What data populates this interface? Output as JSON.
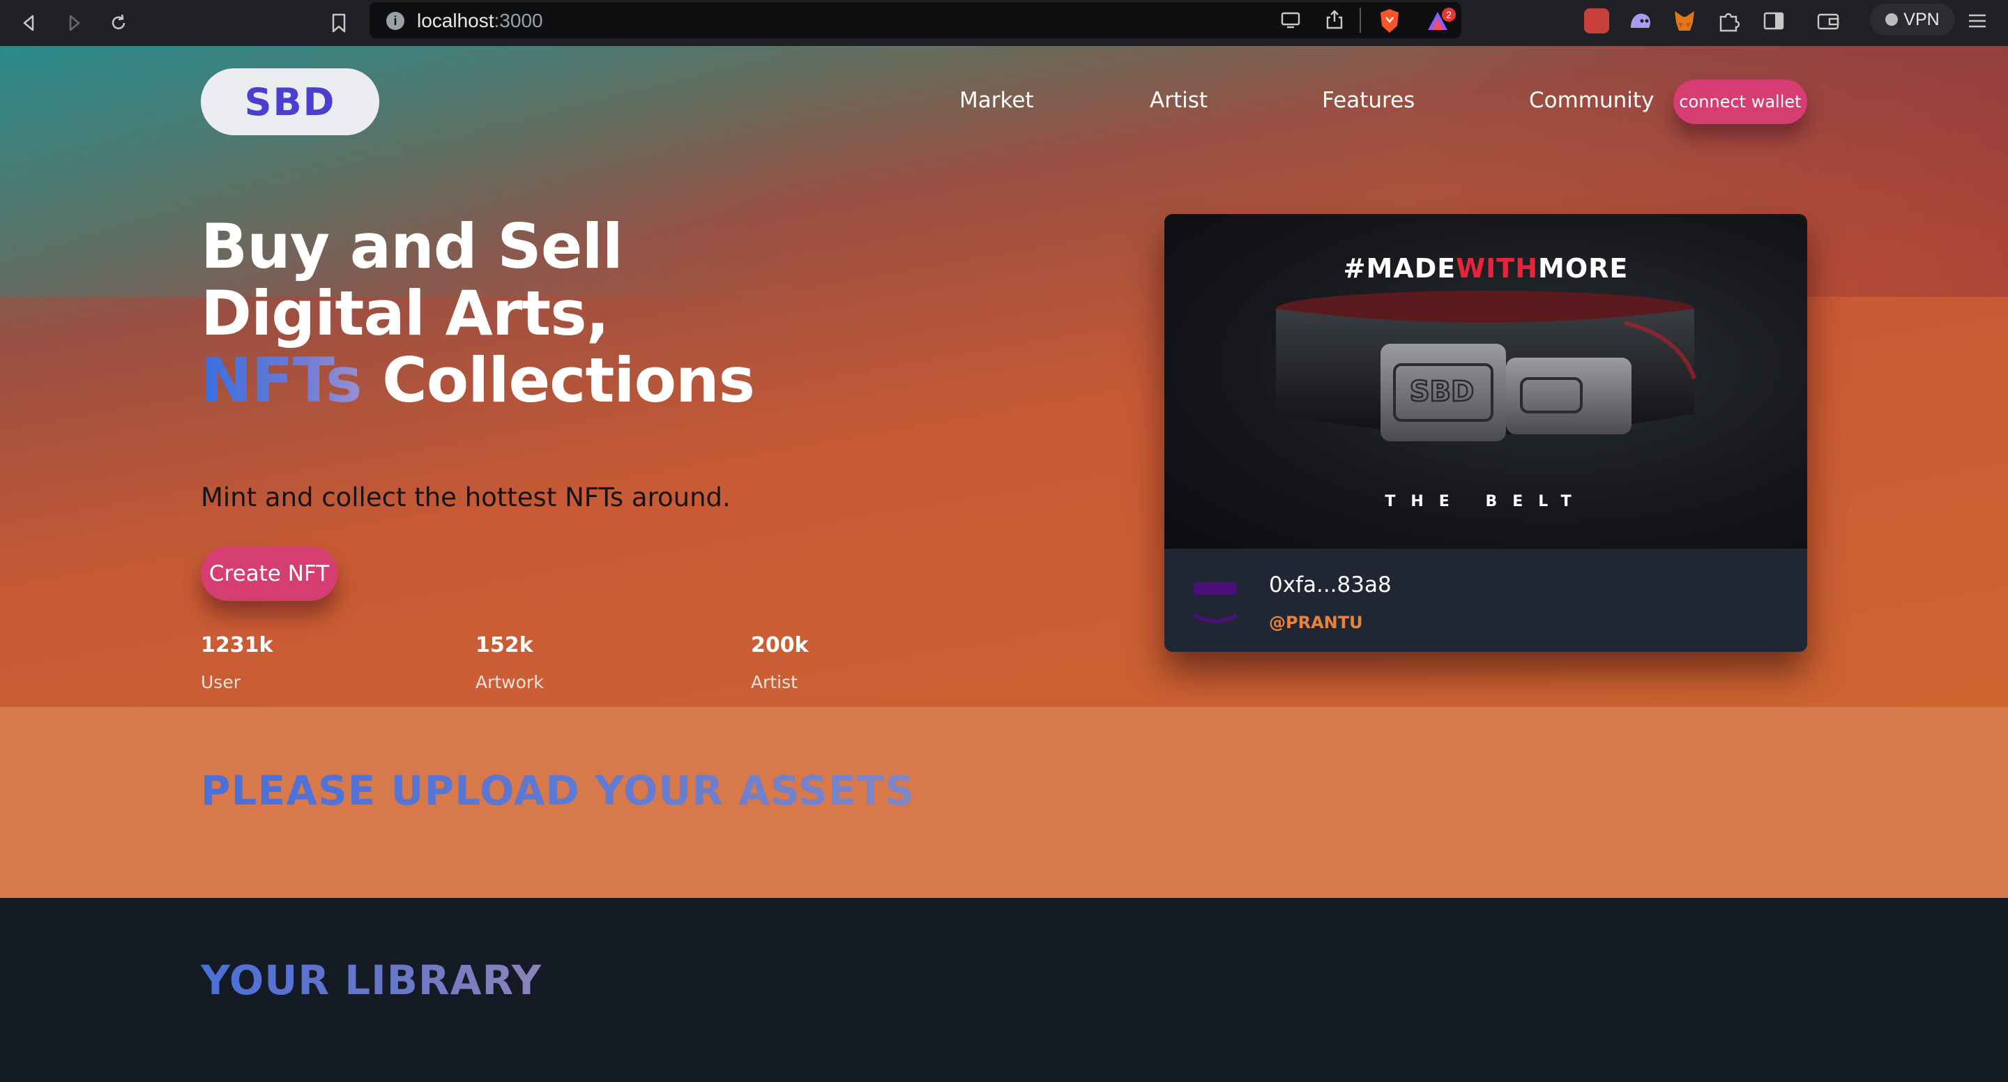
{
  "browser": {
    "url_host": "localhost",
    "url_port": ":3000",
    "vpn_label": "VPN",
    "notification_count": "2"
  },
  "nav": {
    "logo": "SBD",
    "links": [
      "Market",
      "Artist",
      "Features",
      "Community"
    ],
    "connect_label": "connect wallet"
  },
  "hero": {
    "line1": "Buy and Sell",
    "line2": "Digital Arts,",
    "line3_highlight": "NFTs",
    "line3_rest": " Collections",
    "subtitle": "Mint and collect the hottest NFTs around.",
    "create_label": "Create NFT",
    "stats": [
      {
        "value": "1231k",
        "label": "User"
      },
      {
        "value": "152k",
        "label": "Artwork"
      },
      {
        "value": "200k",
        "label": "Artist"
      }
    ]
  },
  "card": {
    "art_title_a": "#MADE",
    "art_title_b": "WITH",
    "art_title_c": "MORE",
    "art_subtitle": "THE BELT",
    "belt_logo": "SBD",
    "address": "0xfa...83a8",
    "handle": "@PRANTU"
  },
  "upload": {
    "title": "PLEASE UPLOAD YOUR ASSETS"
  },
  "library": {
    "title": "YOUR LIBRARY"
  },
  "colors": {
    "accent_pink": "#d63d73",
    "logo_blue": "#4b3fcf",
    "handle_orange": "#e8833a",
    "upload_band": "#d8794b",
    "dark_bg": "#151b25"
  }
}
